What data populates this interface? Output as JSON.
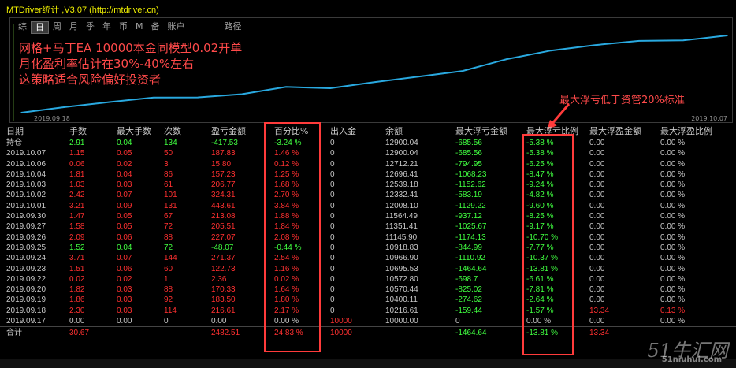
{
  "window": {
    "title": "MTDriver统计 ,V3.07 (http://mtdriver.cn)"
  },
  "tabs": [
    "综",
    "日",
    "周",
    "月",
    "季",
    "年",
    "币",
    "M",
    "备",
    "账户",
    "路径"
  ],
  "active_tab": "日",
  "annotation": {
    "lines": [
      "网格+马丁EA 10000本金同模型0.02开单",
      "月化盈利率估计在30%-40%左右",
      "这策略适合风险偏好投资者"
    ],
    "callout": "最大浮亏低于资管20%标准"
  },
  "chart_data": {
    "type": "line",
    "x": [
      "2019.09.17",
      "2019.09.18",
      "2019.09.19",
      "2019.09.20",
      "2019.09.22",
      "2019.09.23",
      "2019.09.24",
      "2019.09.25",
      "2019.09.26",
      "2019.09.27",
      "2019.09.30",
      "2019.10.01",
      "2019.10.02",
      "2019.10.03",
      "2019.10.04",
      "2019.10.06",
      "2019.10.07"
    ],
    "values": [
      10000,
      10216.61,
      10400.11,
      10570.44,
      10572.8,
      10695.53,
      10966.9,
      10918.83,
      11145.9,
      11351.41,
      11564.49,
      12008.1,
      12332.41,
      12539.18,
      12696.41,
      12712.21,
      12900.04
    ],
    "x_start_label": "2019.09.18",
    "x_end_label": "2019.10.07",
    "line_color": "#29a9e0",
    "grid": false
  },
  "colors": {
    "negative": "#ff3030",
    "positive": "#40ff40",
    "highlight": "#ff3b3b"
  },
  "table": {
    "headers": [
      "日期",
      "手数",
      "最大手数",
      "次数",
      "盈亏金额",
      "百分比%",
      "出入金",
      "余额",
      "最大浮亏金额",
      "最大浮亏比例",
      "最大浮盈金额",
      "最大浮盈比例"
    ],
    "rows": [
      {
        "date": "持仓",
        "lots": "2.91",
        "maxlots": "0.04",
        "count": "134",
        "pnl": "-417.53",
        "pct": "-3.24 %",
        "io": "0",
        "bal": "12900.04",
        "mdd": "-685.56",
        "mddp": "-5.38 %",
        "mfe": "0.00",
        "mfep": "0.00 %",
        "tone": "pos"
      },
      {
        "date": "2019.10.07",
        "lots": "1.15",
        "maxlots": "0.05",
        "count": "50",
        "pnl": "187.83",
        "pct": "1.46 %",
        "io": "0",
        "bal": "12900.04",
        "mdd": "-685.56",
        "mddp": "-5.38 %",
        "mfe": "0.00",
        "mfep": "0.00 %",
        "tone": "neg"
      },
      {
        "date": "2019.10.06",
        "lots": "0.06",
        "maxlots": "0.02",
        "count": "3",
        "pnl": "15.80",
        "pct": "0.12 %",
        "io": "0",
        "bal": "12712.21",
        "mdd": "-794.95",
        "mddp": "-6.25 %",
        "mfe": "0.00",
        "mfep": "0.00 %",
        "tone": "neg"
      },
      {
        "date": "2019.10.04",
        "lots": "1.81",
        "maxlots": "0.04",
        "count": "86",
        "pnl": "157.23",
        "pct": "1.25 %",
        "io": "0",
        "bal": "12696.41",
        "mdd": "-1068.23",
        "mddp": "-8.47 %",
        "mfe": "0.00",
        "mfep": "0.00 %",
        "tone": "neg"
      },
      {
        "date": "2019.10.03",
        "lots": "1.03",
        "maxlots": "0.03",
        "count": "61",
        "pnl": "206.77",
        "pct": "1.68 %",
        "io": "0",
        "bal": "12539.18",
        "mdd": "-1152.62",
        "mddp": "-9.24 %",
        "mfe": "0.00",
        "mfep": "0.00 %",
        "tone": "neg"
      },
      {
        "date": "2019.10.02",
        "lots": "2.42",
        "maxlots": "0.07",
        "count": "101",
        "pnl": "324.31",
        "pct": "2.70 %",
        "io": "0",
        "bal": "12332.41",
        "mdd": "-583.19",
        "mddp": "-4.82 %",
        "mfe": "0.00",
        "mfep": "0.00 %",
        "tone": "neg"
      },
      {
        "date": "2019.10.01",
        "lots": "3.21",
        "maxlots": "0.09",
        "count": "131",
        "pnl": "443.61",
        "pct": "3.84 %",
        "io": "0",
        "bal": "12008.10",
        "mdd": "-1129.22",
        "mddp": "-9.60 %",
        "mfe": "0.00",
        "mfep": "0.00 %",
        "tone": "neg"
      },
      {
        "date": "2019.09.30",
        "lots": "1.47",
        "maxlots": "0.05",
        "count": "67",
        "pnl": "213.08",
        "pct": "1.88 %",
        "io": "0",
        "bal": "11564.49",
        "mdd": "-937.12",
        "mddp": "-8.25 %",
        "mfe": "0.00",
        "mfep": "0.00 %",
        "tone": "neg"
      },
      {
        "date": "2019.09.27",
        "lots": "1.58",
        "maxlots": "0.05",
        "count": "72",
        "pnl": "205.51",
        "pct": "1.84 %",
        "io": "0",
        "bal": "11351.41",
        "mdd": "-1025.67",
        "mddp": "-9.17 %",
        "mfe": "0.00",
        "mfep": "0.00 %",
        "tone": "neg"
      },
      {
        "date": "2019.09.26",
        "lots": "2.09",
        "maxlots": "0.06",
        "count": "88",
        "pnl": "227.07",
        "pct": "2.08 %",
        "io": "0",
        "bal": "11145.90",
        "mdd": "-1174.13",
        "mddp": "-10.70 %",
        "mfe": "0.00",
        "mfep": "0.00 %",
        "tone": "neg"
      },
      {
        "date": "2019.09.25",
        "lots": "1.52",
        "maxlots": "0.04",
        "count": "72",
        "pnl": "-48.07",
        "pct": "-0.44 %",
        "io": "0",
        "bal": "10918.83",
        "mdd": "-844.99",
        "mddp": "-7.77 %",
        "mfe": "0.00",
        "mfep": "0.00 %",
        "tone": "pos"
      },
      {
        "date": "2019.09.24",
        "lots": "3.71",
        "maxlots": "0.07",
        "count": "144",
        "pnl": "271.37",
        "pct": "2.54 %",
        "io": "0",
        "bal": "10966.90",
        "mdd": "-1110.92",
        "mddp": "-10.37 %",
        "mfe": "0.00",
        "mfep": "0.00 %",
        "tone": "neg"
      },
      {
        "date": "2019.09.23",
        "lots": "1.51",
        "maxlots": "0.06",
        "count": "60",
        "pnl": "122.73",
        "pct": "1.16 %",
        "io": "0",
        "bal": "10695.53",
        "mdd": "-1464.64",
        "mddp": "-13.81 %",
        "mfe": "0.00",
        "mfep": "0.00 %",
        "tone": "neg"
      },
      {
        "date": "2019.09.22",
        "lots": "0.02",
        "maxlots": "0.02",
        "count": "1",
        "pnl": "2.36",
        "pct": "0.02 %",
        "io": "0",
        "bal": "10572.80",
        "mdd": "-698.7",
        "mddp": "-6.61 %",
        "mfe": "0.00",
        "mfep": "0.00 %",
        "tone": "neg"
      },
      {
        "date": "2019.09.20",
        "lots": "1.82",
        "maxlots": "0.03",
        "count": "88",
        "pnl": "170.33",
        "pct": "1.64 %",
        "io": "0",
        "bal": "10570.44",
        "mdd": "-825.02",
        "mddp": "-7.81 %",
        "mfe": "0.00",
        "mfep": "0.00 %",
        "tone": "neg"
      },
      {
        "date": "2019.09.19",
        "lots": "1.86",
        "maxlots": "0.03",
        "count": "92",
        "pnl": "183.50",
        "pct": "1.80 %",
        "io": "0",
        "bal": "10400.11",
        "mdd": "-274.62",
        "mddp": "-2.64 %",
        "mfe": "0.00",
        "mfep": "0.00 %",
        "tone": "neg"
      },
      {
        "date": "2019.09.18",
        "lots": "2.30",
        "maxlots": "0.03",
        "count": "114",
        "pnl": "216.61",
        "pct": "2.17 %",
        "io": "0",
        "bal": "10216.61",
        "mdd": "-159.44",
        "mddp": "-1.57 %",
        "mfe": "13.34",
        "mfep": "0.13 %",
        "tone": "neg",
        "mfetone": "neg"
      },
      {
        "date": "2019.09.17",
        "lots": "0.00",
        "maxlots": "0.00",
        "count": "0",
        "pnl": "0.00",
        "pct": "0.00 %",
        "io": "10000",
        "bal": "10000.00",
        "mdd": "0",
        "mddp": "0.00 %",
        "mfe": "0.00",
        "mfep": "0.00 %",
        "tone": "neu",
        "iotone": "neg"
      }
    ],
    "total": {
      "date": "合计",
      "lots": "30.67",
      "maxlots": "",
      "count": "",
      "pnl": "2482.51",
      "pct": "24.83 %",
      "io": "10000",
      "bal": "",
      "mdd": "-1464.64",
      "mddp": "-13.81 %",
      "mfe": "13.34",
      "mfep": ""
    }
  },
  "watermark": {
    "main": "51牛汇网",
    "sub": "51niuhui.com"
  }
}
